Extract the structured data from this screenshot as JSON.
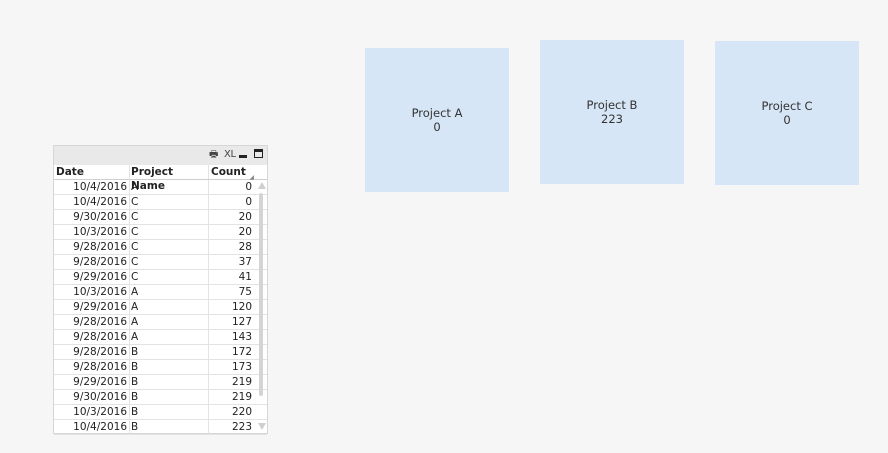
{
  "table": {
    "caption_icons": [
      "print-icon",
      "xl-export-icon",
      "minimize-icon",
      "maximize-icon"
    ],
    "caption_xl_text": "XL",
    "columns": [
      "Date",
      "Project Name",
      "Count"
    ],
    "rows": [
      {
        "date": "10/4/2016",
        "project": "A",
        "count": "0"
      },
      {
        "date": "10/4/2016",
        "project": "C",
        "count": "0"
      },
      {
        "date": "9/30/2016",
        "project": "C",
        "count": "20"
      },
      {
        "date": "10/3/2016",
        "project": "C",
        "count": "20"
      },
      {
        "date": "9/28/2016",
        "project": "C",
        "count": "28"
      },
      {
        "date": "9/28/2016",
        "project": "C",
        "count": "37"
      },
      {
        "date": "9/29/2016",
        "project": "C",
        "count": "41"
      },
      {
        "date": "10/3/2016",
        "project": "A",
        "count": "75"
      },
      {
        "date": "9/29/2016",
        "project": "A",
        "count": "120"
      },
      {
        "date": "9/28/2016",
        "project": "A",
        "count": "127"
      },
      {
        "date": "9/28/2016",
        "project": "A",
        "count": "143"
      },
      {
        "date": "9/28/2016",
        "project": "B",
        "count": "172"
      },
      {
        "date": "9/28/2016",
        "project": "B",
        "count": "173"
      },
      {
        "date": "9/29/2016",
        "project": "B",
        "count": "219"
      },
      {
        "date": "9/30/2016",
        "project": "B",
        "count": "219"
      },
      {
        "date": "10/3/2016",
        "project": "B",
        "count": "220"
      },
      {
        "date": "10/4/2016",
        "project": "B",
        "count": "223"
      }
    ]
  },
  "kpis": [
    {
      "label": "Project A",
      "value": "0"
    },
    {
      "label": "Project B",
      "value": "223"
    },
    {
      "label": "Project C",
      "value": "0"
    }
  ],
  "colors": {
    "background": "#f6f6f6",
    "kpi_fill": "#d6e6f6",
    "table_caption": "#e9e9e9"
  }
}
